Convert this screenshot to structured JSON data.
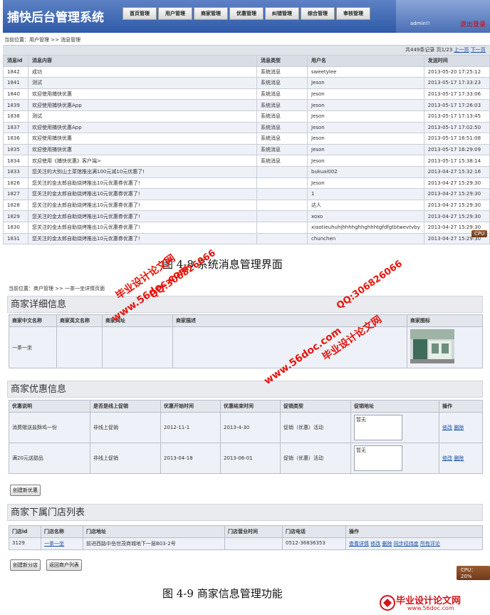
{
  "screenshot1": {
    "app_title": "捕快后台管理系统",
    "nav": [
      "首页管理",
      "用户管理",
      "商家管理",
      "优惠管理",
      "纠错管理",
      "综合管理",
      "审核管理"
    ],
    "user": "admin!!",
    "logout": "退出登录",
    "breadcrumb": "当前位置：用户管理 >> 消息管理",
    "pager": {
      "info": "共449条记录 页1/23",
      "prev": "上一页",
      "next": "下一页"
    },
    "columns": [
      "消息id",
      "消息内容",
      "消息类型",
      "用户名",
      "发送时间"
    ],
    "rows": [
      [
        "1842",
        "成功",
        "系统消息",
        "sweetylee",
        "2013-05-20 17:25:12"
      ],
      [
        "1841",
        "测试",
        "系统消息",
        "Jeson",
        "2013-05-17 17:33:23"
      ],
      [
        "1840",
        "欢迎使用捕快优惠",
        "系统消息",
        "Jeson",
        "2013-05-17 17:33:06"
      ],
      [
        "1839",
        "欢迎使用捕快优惠App",
        "系统消息",
        "Jeson",
        "2013-05-17 17:26:03"
      ],
      [
        "1838",
        "测试",
        "系统消息",
        "Jeson",
        "2013-05-17 17:13:45"
      ],
      [
        "1837",
        "欢迎使用捕快优惠App",
        "系统消息",
        "Jeson",
        "2013-05-17 17:02:50"
      ],
      [
        "1836",
        "欢迎使用捕快优惠",
        "系统消息",
        "Jeson",
        "2013-05-17 16:51:08"
      ],
      [
        "1835",
        "欢迎使用捕快优惠",
        "系统消息",
        "Jeson",
        "2013-05-17 16:29:09"
      ],
      [
        "1834",
        "欢迎使用《捕快优惠》客户端>",
        "系统消息",
        "Jeson",
        "2013-05-17 15:38:14"
      ],
      [
        "1833",
        "您关注的大别山土菜馆推出满100元减10元优惠了!",
        "",
        "bukuai002",
        "2013-04-27 15:32:16"
      ],
      [
        "1826",
        "您关注的金太郎自助烧烤推出10元优惠券优惠了!",
        "",
        "Jeson",
        "2013-04-27 15:29:30"
      ],
      [
        "1827",
        "您关注的金太郎自助烧烤推出10元优惠券优惠了!",
        "",
        "1",
        "2013-04-27 15:29:30"
      ],
      [
        "1828",
        "您关注的金太郎自助烧烤推出10元优惠券优惠了!",
        "",
        "达人",
        "2013-04-27 15:29:30"
      ],
      [
        "1829",
        "您关注的金太郎自助烧烤推出10元优惠券优惠了!",
        "",
        "xoxo",
        "2013-04-27 15:29:30"
      ],
      [
        "1830",
        "您关注的金太郎自助烧烤推出10元优惠券优惠了!",
        "",
        "xiaotieuhuhjhhhhghhghhhtgfdfgtbtwevtvby",
        "2013-04-27 15:29:30"
      ],
      [
        "1831",
        "您关注的金太郎自助烧烤推出10元优惠券优惠了!",
        "",
        "chunchen",
        "2013-04-27 15:29:30"
      ]
    ],
    "cpu": "CPU"
  },
  "caption1": "图 4-8    系统消息管理界面",
  "screenshot2": {
    "breadcrumb": "当前位置：商户管理 >> 一茶一坐详情页面",
    "merchant_section": "商家详细信息",
    "merchant_columns": [
      "商家中文名称",
      "商家英文名称",
      "商家网址",
      "商家描述",
      "商家图标"
    ],
    "merchant_row": {
      "cn_name": "一茶一坐",
      "en_name": "",
      "url": "",
      "desc": ""
    },
    "promo_section": "商家优惠信息",
    "promo_columns": [
      "优惠说明",
      "是否是线上促销",
      "优惠开始时间",
      "优惠结束时间",
      "促销类型",
      "促销地址",
      "操作"
    ],
    "promo_rows": [
      {
        "desc": "消费赠送盐酥鸡一份",
        "online": "非线上促销",
        "start": "2012-11-1",
        "end": "2013-4-30",
        "type": "促销（优惠）活动",
        "addr": "暂无",
        "edit": "修改",
        "del": "删除"
      },
      {
        "desc": "满20元送甜品",
        "online": "非线上促销",
        "start": "2013-04-18",
        "end": "2013-06-01",
        "type": "促销（优惠）活动",
        "addr": "暂无",
        "edit": "修改",
        "del": "删除"
      }
    ],
    "btn_new_promo": "创建新优惠",
    "shop_section": "商家下属门店列表",
    "shop_columns": [
      "门店id",
      "门店名称",
      "门店地址",
      "门店营业时间",
      "门店电话",
      "操作"
    ],
    "shop_row": {
      "id": "3129",
      "name": "一茶一坐",
      "addr": "前进西路中岳世茂商城地下一层B03-2号",
      "hours": "",
      "phone": "0512-36836353",
      "ops": [
        "查看详情",
        "修改",
        "删除",
        "同步经纬度",
        "所有评论"
      ]
    },
    "btn_new_shop": "创建新分店",
    "btn_back": "返回商户列表",
    "cpu": "CPU：20%"
  },
  "caption2": "图 4-9    商家信息管理功能",
  "watermarks": {
    "w1": "毕业设计论文网",
    "w2": "www.56doc.com",
    "w3": "QQ:306826066",
    "logo": "毕业设计论文网",
    "logo_url": "www.56doc.com"
  },
  "colors": {
    "header": "#2f5aa8",
    "watermark": "#e8140c",
    "cpu": "#6d3a1c"
  }
}
